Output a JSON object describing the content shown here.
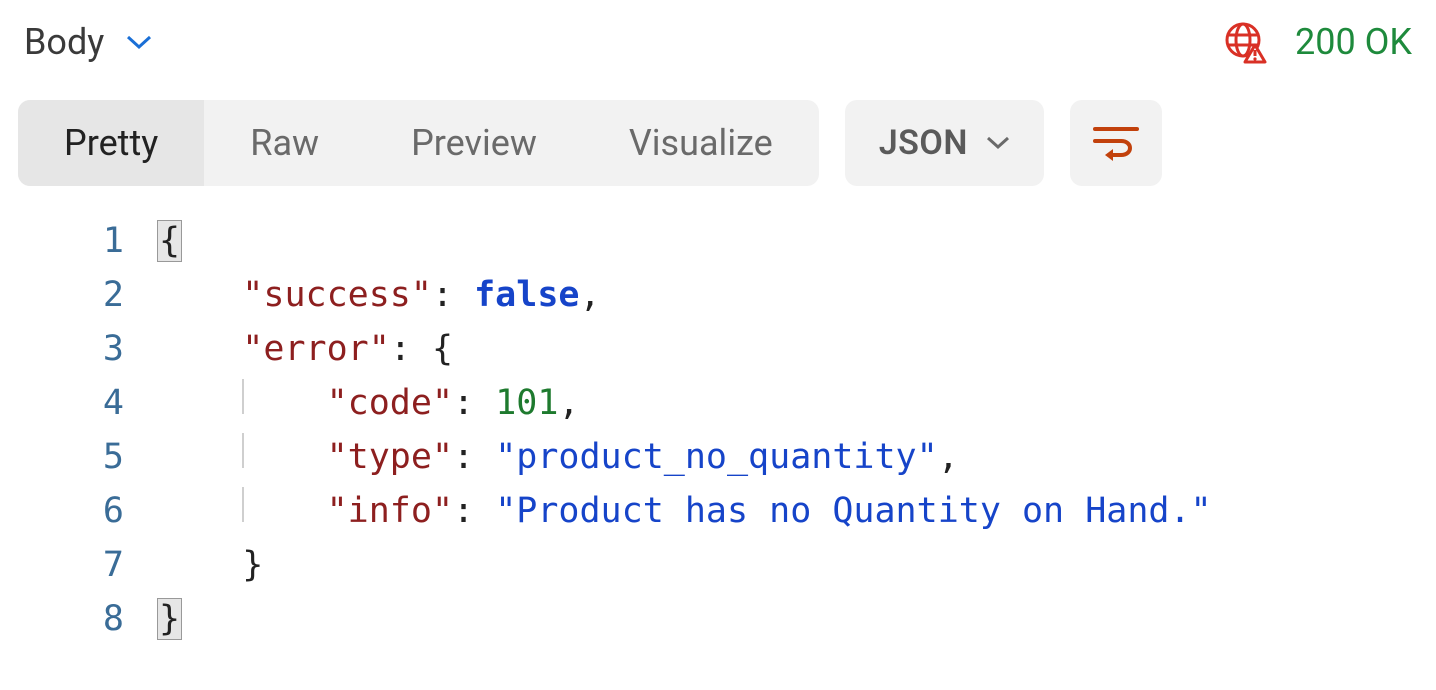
{
  "header": {
    "body_label": "Body",
    "status_text": "200 OK"
  },
  "tabs": {
    "pretty": "Pretty",
    "raw": "Raw",
    "preview": "Preview",
    "visualize": "Visualize"
  },
  "format": {
    "selected": "JSON"
  },
  "lines": {
    "l1": "1",
    "l2": "2",
    "l3": "3",
    "l4": "4",
    "l5": "5",
    "l6": "6",
    "l7": "7",
    "l8": "8"
  },
  "tokens": {
    "brace_open": "{",
    "brace_close": "}",
    "colon": ":",
    "comma": ",",
    "key_success": "\"success\"",
    "val_false": "false",
    "key_error": "\"error\"",
    "key_code": "\"code\"",
    "val_101": "101",
    "key_type": "\"type\"",
    "val_type": "\"product_no_quantity\"",
    "key_info": "\"info\"",
    "val_info": "\"Product has no Quantity on Hand.\""
  },
  "response_body": {
    "success": false,
    "error": {
      "code": 101,
      "type": "product_no_quantity",
      "info": "Product has no Quantity on Hand."
    }
  }
}
